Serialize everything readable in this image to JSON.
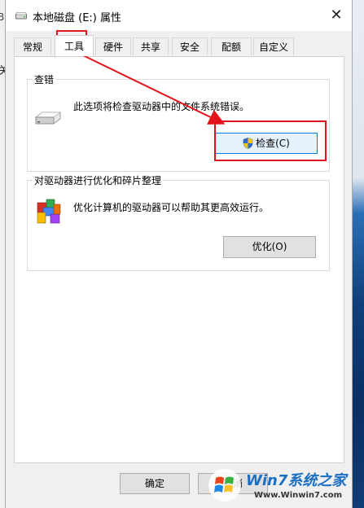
{
  "window": {
    "title": "本地磁盘 (E:) 属性",
    "close_glyph": "✕"
  },
  "background": {
    "left_char_top": "B",
    "left_char_mid": "关"
  },
  "tabs": [
    {
      "label": "常规"
    },
    {
      "label": "工具"
    },
    {
      "label": "硬件"
    },
    {
      "label": "共享"
    },
    {
      "label": "安全"
    },
    {
      "label": "配额"
    },
    {
      "label": "自定义"
    }
  ],
  "active_tab": "工具",
  "error_check": {
    "title": "查错",
    "description": "此选项将检查驱动器中的文件系统错误。",
    "button_label": "检查(C)"
  },
  "optimize": {
    "title": "对驱动器进行优化和碎片整理",
    "description": "优化计算机的驱动器可以帮助其更高效运行。",
    "button_label": "优化(O)"
  },
  "footer": {
    "ok_label": "确定",
    "cancel_label": "取消"
  },
  "watermark": {
    "brand": "Win7系统之家",
    "url": "Www.Winwin7.com"
  },
  "colors": {
    "annotation": "#e2131b",
    "focus_border": "#0078d7"
  }
}
